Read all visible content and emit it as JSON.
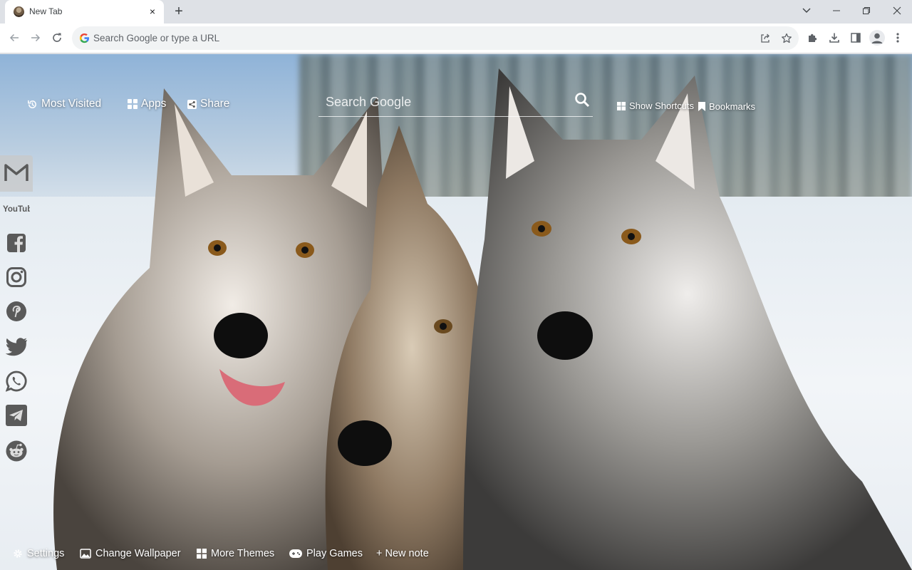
{
  "browser": {
    "tab": {
      "title": "New Tab",
      "close_glyph": "×",
      "favicon": "wolf-favicon-icon"
    },
    "new_tab_glyph": "+",
    "window_controls": [
      "tab-search-icon",
      "minimize-icon",
      "restore-icon",
      "close-icon"
    ],
    "omnibox": {
      "placeholder": "Search Google or type a URL"
    },
    "toolbar_icons": [
      "share-icon",
      "bookmark-star-icon",
      "extensions-icon",
      "download-icon",
      "side-panel-icon",
      "profile-icon",
      "menu-icon"
    ]
  },
  "ntp": {
    "top_links": {
      "most_visited": "Most Visited",
      "apps": "Apps",
      "share": "Share",
      "show_shortcuts": "Show Shortcuts",
      "bookmarks": "Bookmarks"
    },
    "search": {
      "placeholder": "Search Google"
    },
    "social": [
      "gmail-icon",
      "youtube-icon",
      "facebook-icon",
      "instagram-icon",
      "pinterest-icon",
      "twitter-icon",
      "whatsapp-icon",
      "telegram-icon",
      "reddit-icon"
    ],
    "youtube_label": "YouTube",
    "bottom_links": {
      "settings": "Settings",
      "change_wallpaper": "Change Wallpaper",
      "more_themes": "More Themes",
      "play_games": "Play Games",
      "new_note": "+ New note"
    },
    "colors": {
      "chrome_bg": "#dee1e6",
      "toolbar_bg": "#ffffff",
      "omnibox_bg": "#f1f3f4",
      "social_icon": "#5a5a5a"
    }
  }
}
